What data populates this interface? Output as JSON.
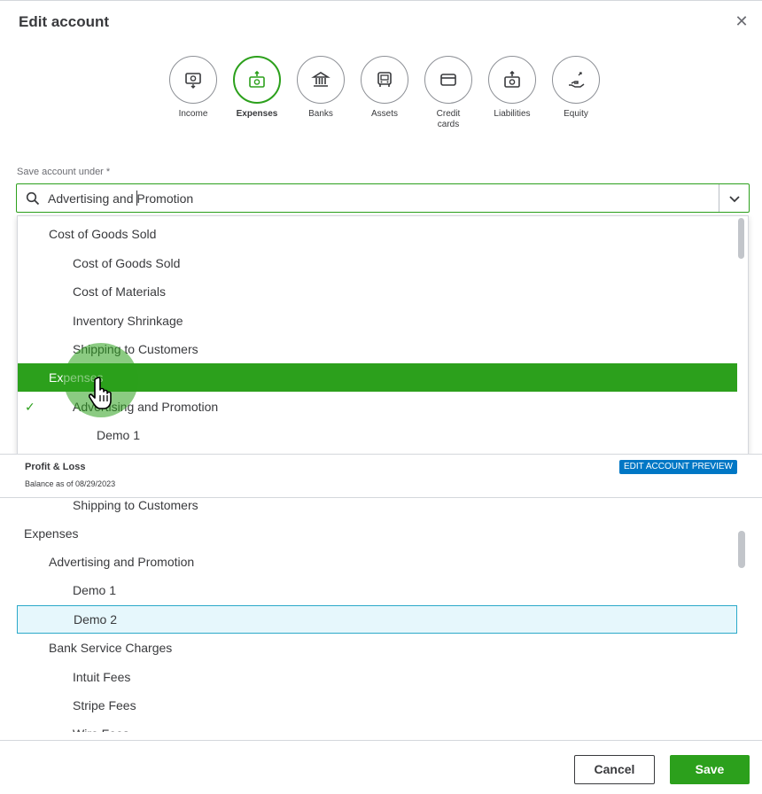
{
  "dialog": {
    "title": "Edit account",
    "close_icon": "close-icon"
  },
  "account_types": [
    {
      "label": "Income",
      "icon": "income-icon",
      "active": false
    },
    {
      "label": "Expenses",
      "icon": "expenses-icon",
      "active": true
    },
    {
      "label": "Banks",
      "icon": "bank-icon",
      "active": false
    },
    {
      "label": "Assets",
      "icon": "assets-icon",
      "active": false
    },
    {
      "label": "Credit\ncards",
      "icon": "credit-card-icon",
      "active": false
    },
    {
      "label": "Liabilities",
      "icon": "liabilities-icon",
      "active": false
    },
    {
      "label": "Equity",
      "icon": "equity-icon",
      "active": false
    }
  ],
  "save_under": {
    "label": "Save account under *",
    "value": "Advertising and Promotion"
  },
  "dropdown": {
    "items": [
      {
        "label": "Cost of Goods Sold",
        "level": 1,
        "selected": false,
        "checked": false
      },
      {
        "label": "Cost of Goods Sold",
        "level": 2,
        "selected": false,
        "checked": false
      },
      {
        "label": "Cost of Materials",
        "level": 2,
        "selected": false,
        "checked": false
      },
      {
        "label": "Inventory Shrinkage",
        "level": 2,
        "selected": false,
        "checked": false
      },
      {
        "label": "Shipping to Customers",
        "level": 2,
        "selected": false,
        "checked": false
      },
      {
        "label": "Expenses",
        "level": 1,
        "selected": true,
        "checked": false
      },
      {
        "label": "Advertising and Promotion",
        "level": 2,
        "selected": false,
        "checked": true
      },
      {
        "label": "Demo 1",
        "level": 3,
        "selected": false,
        "checked": false
      }
    ],
    "check_mark": "✓"
  },
  "profit_loss": {
    "title": "Profit & Loss",
    "subtitle": "Balance as of 08/29/2023",
    "badge": "EDIT ACCOUNT PREVIEW"
  },
  "preview": {
    "items": [
      {
        "label": "Shipping to Customers",
        "level": 2,
        "highlight": false
      },
      {
        "label": "Expenses",
        "level": 0,
        "highlight": false
      },
      {
        "label": "Advertising and Promotion",
        "level": 1,
        "highlight": false
      },
      {
        "label": "Demo 1",
        "level": 2,
        "highlight": false
      },
      {
        "label": "Demo 2",
        "level": 2,
        "highlight": true
      },
      {
        "label": "Bank Service Charges",
        "level": 1,
        "highlight": false
      },
      {
        "label": "Intuit Fees",
        "level": 2,
        "highlight": false
      },
      {
        "label": "Stripe Fees",
        "level": 2,
        "highlight": false
      },
      {
        "label": "Wire Fees",
        "level": 2,
        "highlight": false
      }
    ]
  },
  "footer": {
    "cancel_label": "Cancel",
    "save_label": "Save"
  },
  "colors": {
    "accent": "#2ca01c",
    "badge": "#0077c5",
    "highlight_bg": "#e6f7fc",
    "highlight_border": "#2ba9c9"
  }
}
